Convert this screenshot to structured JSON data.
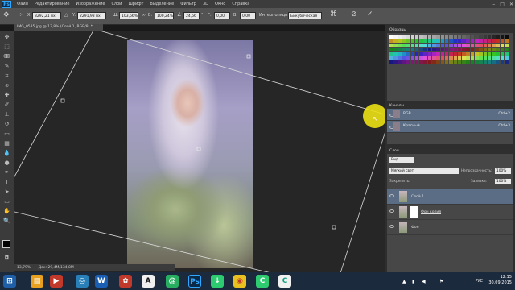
{
  "app": {
    "logo": "Ps"
  },
  "menu": [
    "Файл",
    "Редактирование",
    "Изображение",
    "Слои",
    "Шрифт",
    "Выделение",
    "Фильтр",
    "3D",
    "Окно",
    "Справка"
  ],
  "options": {
    "x_value": "3292,21 пх",
    "y_value": "2291,98 пх",
    "w_value": "103,66%",
    "h_value": "100,24%",
    "angle_value": "24,66",
    "hskew_value": "0,00",
    "vskew_value": "0,00",
    "interp_label": "Интерполяция:",
    "interp_value": "Бикубическая"
  },
  "document": {
    "tab_title": "IMG_0585.jpg @ 13,8% (Слой 1, RGB/8) *",
    "status": "Док: 29,4M/134,8M",
    "zoom": "13,79%"
  },
  "panels": {
    "swatches_title": "Образцы",
    "channels_title": "Каналы",
    "channels": [
      {
        "name": "RGB",
        "shortcut": "Ctrl+2"
      },
      {
        "name": "Красный",
        "shortcut": "Ctrl+3"
      }
    ],
    "layers_title": "Слои",
    "kind_value": "Вид",
    "blend_mode": "Мягкий свет",
    "opacity_label": "Непрозрачность:",
    "opacity_value": "100%",
    "lock_label": "Закрепить:",
    "fill_label": "Заливка:",
    "fill_value": "100%",
    "layers": [
      {
        "name": "Слой 1"
      },
      {
        "name": "Фон копия"
      },
      {
        "name": "Фон"
      }
    ]
  },
  "taskbar": {
    "lang": "РУС",
    "time": "12:15",
    "date": "30.09.2015"
  },
  "colors": {
    "accent_highlight": "#ebe114",
    "selected_layer": "#5a6d85"
  }
}
